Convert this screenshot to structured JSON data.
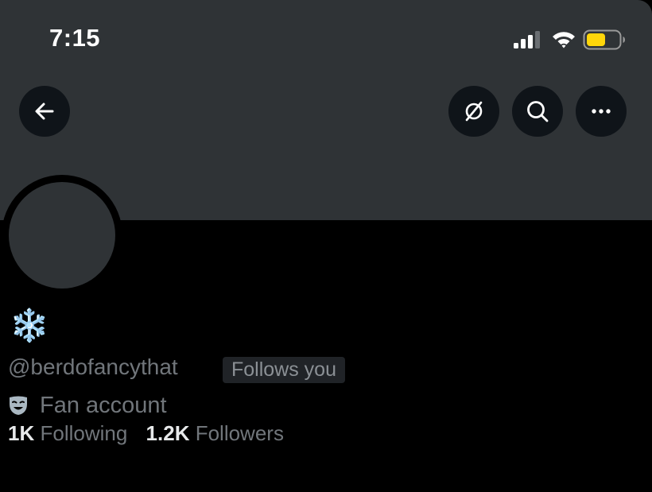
{
  "status_bar": {
    "time": "7:15",
    "signal_icon": "cellular-signal-icon",
    "wifi_icon": "wifi-icon",
    "battery_icon": "battery-icon",
    "battery_color": "#ffd60a"
  },
  "toolbar": {
    "back_icon": "arrow-left-icon",
    "hide_icon": "crossed-circle-icon",
    "search_icon": "search-icon",
    "more_icon": "more-horizontal-icon"
  },
  "profile": {
    "display_name": "❄️",
    "handle": "@berdofancythat",
    "follows_you": "Follows you",
    "category_icon": "theater-mask-icon",
    "category": "Fan account",
    "following_count": "1K",
    "following_label": "Following",
    "followers_count": "1.2K",
    "followers_label": "Followers"
  },
  "colors": {
    "banner": "#2f3336",
    "button_bg": "#0f1419",
    "secondary_text": "#71767b",
    "primary_text": "#e7e9ea"
  }
}
